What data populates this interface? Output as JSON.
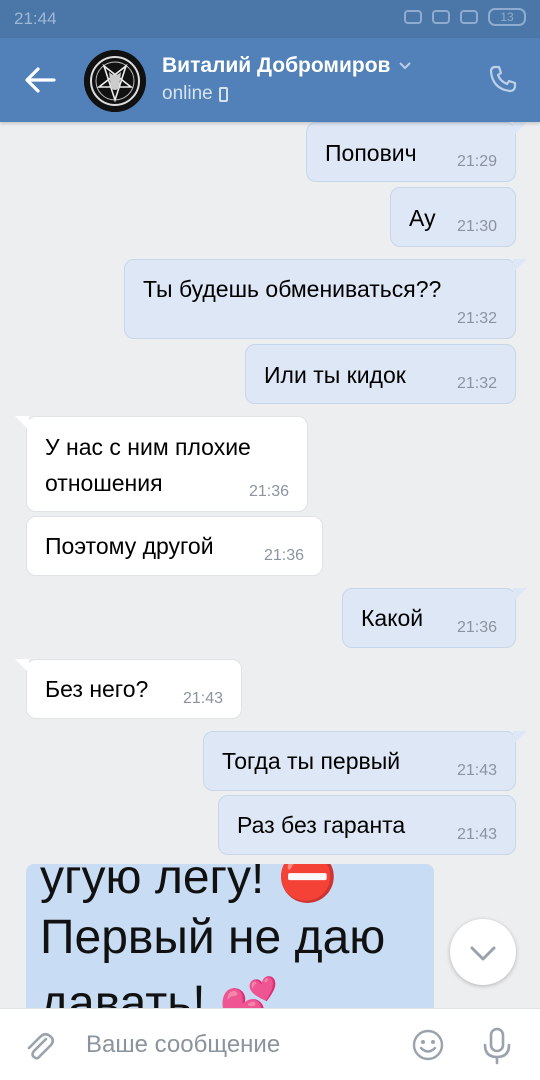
{
  "statusbar": {
    "time": "21:44",
    "battery": "13"
  },
  "header": {
    "contact_name": "Виталий Добромиров",
    "status": "online"
  },
  "messages": [
    {
      "dir": "out",
      "text": "Попович",
      "time": "21:29"
    },
    {
      "dir": "out",
      "text": "Ау",
      "time": "21:30"
    },
    {
      "dir": "out",
      "text": "Ты будешь обмениваться??",
      "time": "21:32"
    },
    {
      "dir": "out",
      "text": "Или ты кидок",
      "time": "21:32"
    },
    {
      "dir": "in",
      "text": "У нас с ним плохие отношения",
      "time": "21:36"
    },
    {
      "dir": "in",
      "text": "Поэтому другой",
      "time": "21:36"
    },
    {
      "dir": "out",
      "text": "Какой",
      "time": "21:36"
    },
    {
      "dir": "in",
      "text": "Без него?",
      "time": "21:43"
    },
    {
      "dir": "out",
      "text": "Тогда ты первый",
      "time": "21:43"
    },
    {
      "dir": "out",
      "text": "Раз без гаранта",
      "time": "21:43"
    }
  ],
  "image_message": {
    "line1": "угую легу! ⛔",
    "line2": "Первый не даю",
    "line3": "давать! 💕"
  },
  "composer": {
    "placeholder": "Ваше сообщение"
  },
  "colors": {
    "header": "#5181b8",
    "statusbar": "#4a76a8",
    "bubble_out": "#dde7f5",
    "bubble_in": "#ffffff",
    "background": "#edeef0"
  }
}
